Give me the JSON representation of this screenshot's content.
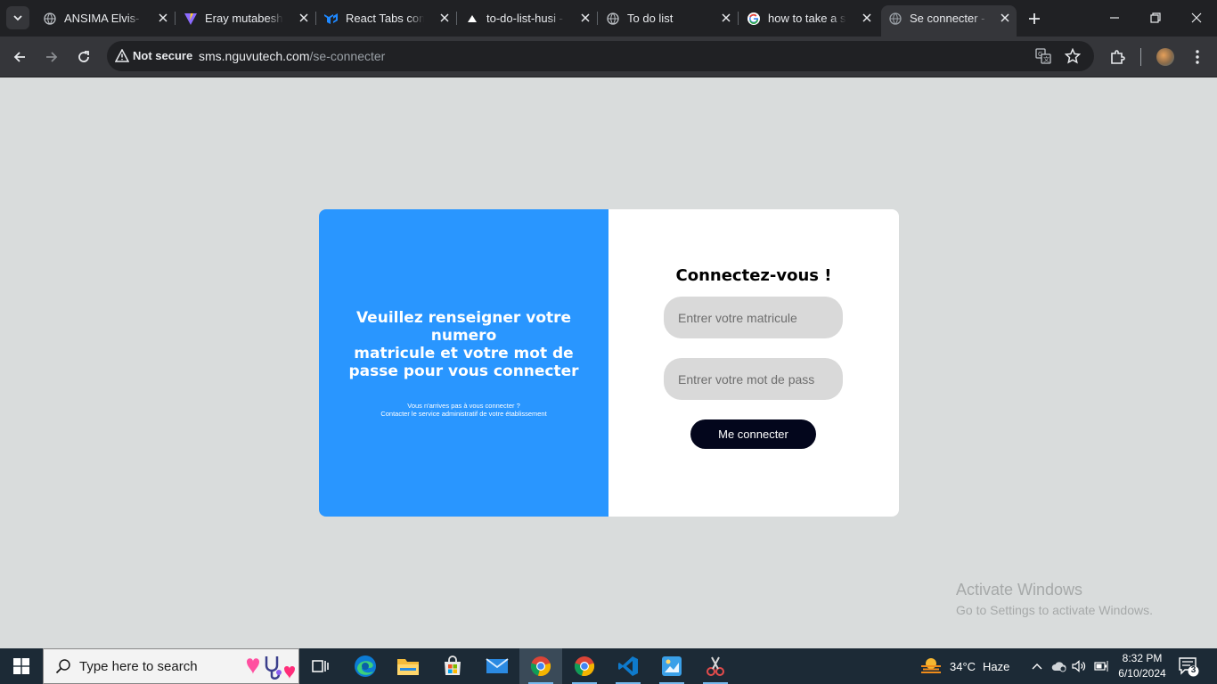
{
  "browser": {
    "tabs": [
      {
        "title": "ANSIMA Elvis- M",
        "icon": "globe-icon"
      },
      {
        "title": "Eray mutabesha",
        "icon": "vite-icon"
      },
      {
        "title": "React Tabs comp",
        "icon": "mui-icon"
      },
      {
        "title": "to-do-list-husi -",
        "icon": "vercel-icon"
      },
      {
        "title": "To do list",
        "icon": "globe-icon"
      },
      {
        "title": "how to take a sc",
        "icon": "google-icon"
      },
      {
        "title": "Se connecter - S",
        "icon": "globe-icon",
        "active": true
      }
    ],
    "security_label": "Not secure",
    "url_domain": "sms.nguvutech.com",
    "url_path": "/se-connecter"
  },
  "page": {
    "left_panel": {
      "heading_lines": [
        "Veuillez renseigner votre",
        "numero",
        "matricule et votre mot de",
        "passe pour vous connecter"
      ],
      "note_lines": [
        "Vous n'arrives pas à vous connecter ?",
        "Contacter le service administratif de votre établissement"
      ]
    },
    "form": {
      "title": "Connectez-vous !",
      "matricule_placeholder": "Entrer votre matricule",
      "password_placeholder": "Entrer votre mot de pass",
      "submit_label": "Me connecter"
    },
    "colors": {
      "left_panel_bg": "#2996ff",
      "submit_bg": "#03061c",
      "page_bg": "#d9dcdc"
    }
  },
  "watermark": {
    "line1": "Activate Windows",
    "line2": "Go to Settings to activate Windows."
  },
  "taskbar": {
    "search_placeholder": "Type here to search",
    "weather_temp": "34°C",
    "weather_desc": "Haze",
    "time": "8:32 PM",
    "date": "6/10/2024",
    "notification_count": "3",
    "apps": [
      "task-view",
      "edge",
      "file-explorer",
      "microsoft-store",
      "mail",
      "chrome",
      "chrome",
      "vscode",
      "paint",
      "snipping-tool"
    ]
  }
}
